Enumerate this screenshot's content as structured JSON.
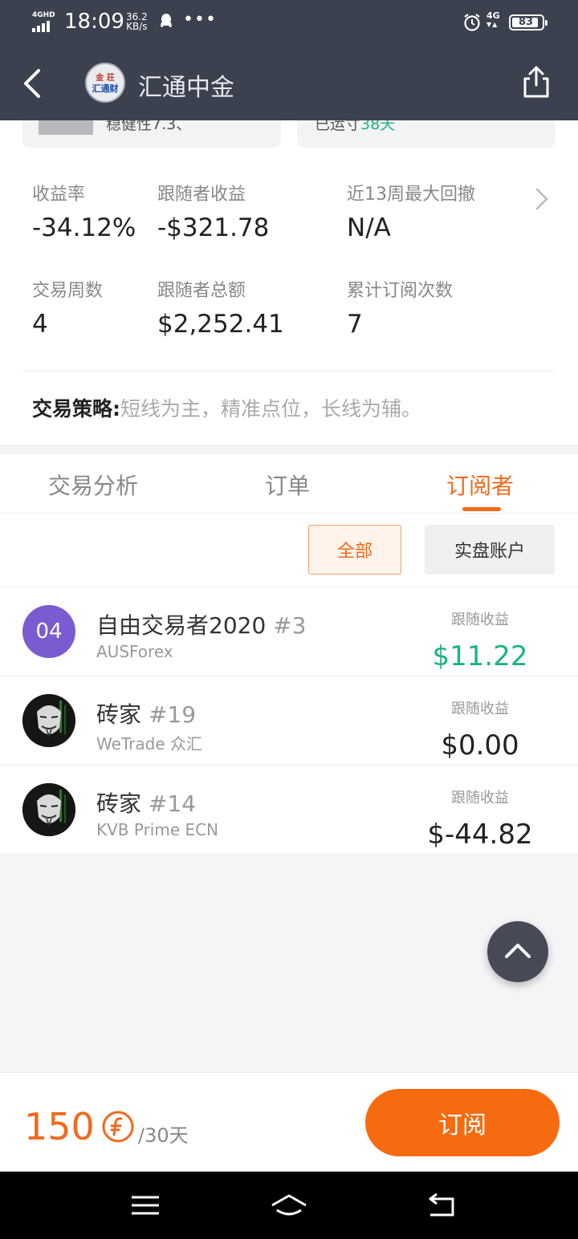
{
  "status_bar": {
    "network": "4GHD",
    "time": "18:09",
    "speed_value": "36.2",
    "speed_unit": "KB/s",
    "more": "•••",
    "cell": "4G",
    "battery": "83"
  },
  "header": {
    "title": "汇通中金",
    "logo_text_top": "金 荘",
    "logo_text_bottom": "汇通财"
  },
  "top_cards": [
    {
      "cut_text": "稳健性7.3、"
    },
    {
      "cut_text_prefix": "已运寸",
      "cut_text_value": "38天"
    }
  ],
  "stats": [
    {
      "label": "收益率",
      "value": "-34.12%"
    },
    {
      "label": "跟随者收益",
      "value": "-$321.78"
    },
    {
      "label": "近13周最大回撤",
      "value": "N/A"
    },
    {
      "label": "交易周数",
      "value": "4"
    },
    {
      "label": "跟随者总额",
      "value": "$2,252.41"
    },
    {
      "label": "累计订阅次数",
      "value": "7"
    }
  ],
  "strategy": {
    "label": "交易策略:",
    "text": "短线为主，精准点位，长线为辅。"
  },
  "tabs": [
    {
      "label": "交易分析",
      "active": false
    },
    {
      "label": "订单",
      "active": false
    },
    {
      "label": "订阅者",
      "active": true
    }
  ],
  "filters": {
    "all": "全部",
    "real": "实盘账户",
    "selected": "全部"
  },
  "subscribers": [
    {
      "avatar": "04",
      "name": "自由交易者2020",
      "rank": "#3",
      "broker": "AUSForex",
      "profit_label": "跟随收益",
      "profit": "$11.22",
      "positive": true
    },
    {
      "avatar": "",
      "name": "砖家",
      "rank": "#19",
      "broker": "WeTrade 众汇",
      "profit_label": "跟随收益",
      "profit": "$0.00",
      "positive": false
    },
    {
      "avatar": "",
      "name": "砖家",
      "rank": "#14",
      "broker": "KVB Prime ECN",
      "profit_label": "跟随收益",
      "profit": "$-44.82",
      "positive": false
    }
  ],
  "footer": {
    "price": "150",
    "period": "/30天",
    "subscribe": "订阅"
  },
  "colors": {
    "accent": "#f26a1b",
    "positive": "#1bb57b",
    "header_bg": "#3c4150"
  }
}
